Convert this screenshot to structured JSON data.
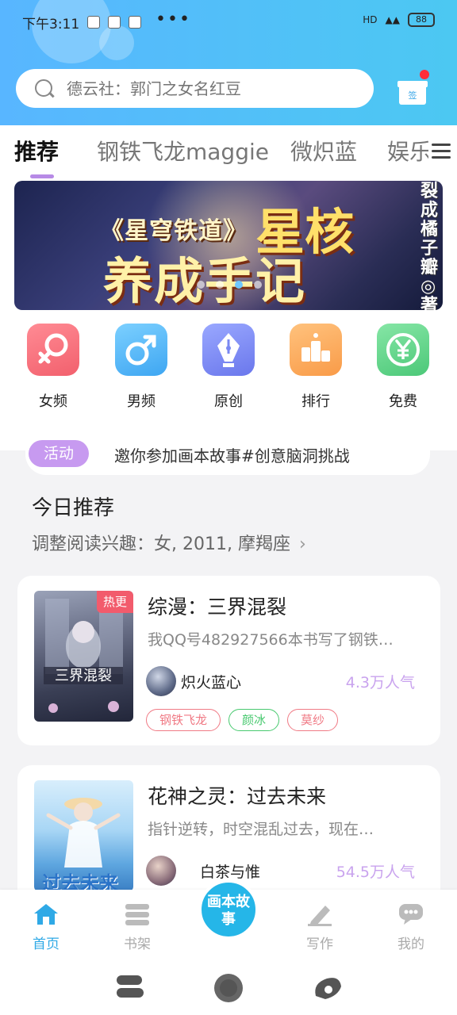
{
  "status_bar": {
    "time": "下午3:11",
    "more": "•••",
    "right_text": "HD",
    "battery": "88"
  },
  "search": {
    "placeholder": "德云社：郭门之女名红豆"
  },
  "gift": {
    "label": "签"
  },
  "tabs": [
    {
      "label": "推荐",
      "active": true
    },
    {
      "label": "钢铁飞龙maggie"
    },
    {
      "label": "微炽蓝"
    },
    {
      "label": "娱乐"
    }
  ],
  "banner": {
    "subtitle": "《星穹铁道》",
    "title_line1": "星核",
    "title_line2": "养成手记",
    "author": "裂成橘子瓣◎著",
    "dots": 4,
    "active_dot": 2
  },
  "categories": [
    {
      "label": "女频",
      "icon": "female-icon",
      "color": "#f56d79"
    },
    {
      "label": "男频",
      "icon": "male-icon",
      "color": "#4ab3f5"
    },
    {
      "label": "原创",
      "icon": "pen-icon",
      "color": "#7a88f2"
    },
    {
      "label": "排行",
      "icon": "ranking-icon",
      "color": "#fbb064"
    },
    {
      "label": "免费",
      "icon": "yen-icon",
      "color": "#5fd48a"
    }
  ],
  "activity": {
    "badge": "活动",
    "text": "邀你参加画本故事#创意脑洞挑战"
  },
  "today": {
    "title": "今日推荐",
    "preference": "调整阅读兴趣：女, 2011, 摩羯座"
  },
  "books": [
    {
      "title": "综漫：三界混裂",
      "description": "我QQ号482927566本书写了钢铁…",
      "author": "炽火蓝心",
      "popularity": "4.3万人气",
      "badge": "热更",
      "tags": [
        {
          "label": "钢铁飞龙",
          "color": "#f07a85"
        },
        {
          "label": "颜冰",
          "color": "#48c96f"
        },
        {
          "label": "莫纱",
          "color": "#f07a85"
        }
      ]
    },
    {
      "title": "花神之灵：过去未来",
      "description": "指针逆转，时空混乱过去，现在…",
      "author": "白茶与惟",
      "popularity": "54.5万人气",
      "cover_text": "过去未来"
    }
  ],
  "bottom_nav": {
    "home": "首页",
    "shelf": "书架",
    "center": "画本故事",
    "write": "写作",
    "mine": "我的"
  },
  "colors": {
    "accent": "#25b6e8",
    "purple": "#c79af0",
    "header": "#58b6ff"
  }
}
